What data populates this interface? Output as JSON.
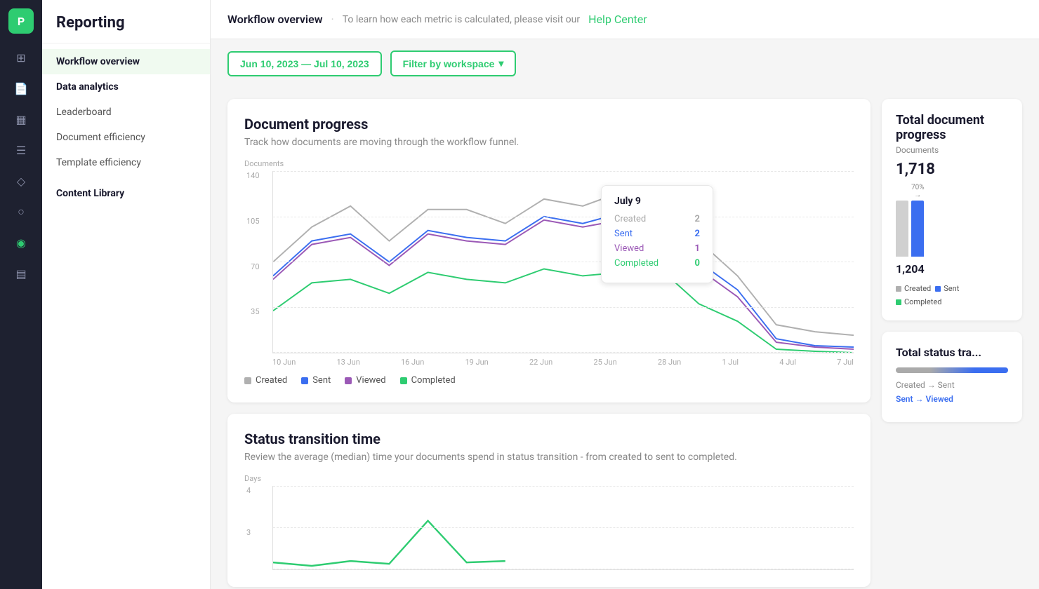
{
  "app": {
    "logo_text": "P"
  },
  "iconbar": {
    "items": [
      {
        "name": "grid-icon",
        "symbol": "⊞",
        "active": false
      },
      {
        "name": "doc-icon",
        "symbol": "📄",
        "active": false
      },
      {
        "name": "template-icon",
        "symbol": "▦",
        "active": false
      },
      {
        "name": "table-icon",
        "symbol": "⊟",
        "active": false
      },
      {
        "name": "tag-icon",
        "symbol": "🏷",
        "active": false
      },
      {
        "name": "user-icon",
        "symbol": "👤",
        "active": false
      },
      {
        "name": "chart-icon",
        "symbol": "📊",
        "active": true
      },
      {
        "name": "slides-icon",
        "symbol": "▤",
        "active": false
      }
    ]
  },
  "sidebar": {
    "title": "Reporting",
    "items": [
      {
        "label": "Workflow overview",
        "active": true,
        "bold": true
      },
      {
        "label": "Data analytics",
        "active": false,
        "bold": true
      },
      {
        "label": "Leaderboard",
        "active": false,
        "bold": false
      },
      {
        "label": "Document efficiency",
        "active": false,
        "bold": false
      },
      {
        "label": "Template efficiency",
        "active": false,
        "bold": false
      },
      {
        "label": "Content Library",
        "active": false,
        "bold": true
      }
    ]
  },
  "topbar": {
    "title": "Workflow overview",
    "help_text": "To learn how each metric is calculated, please visit our",
    "help_link_text": "Help Center",
    "help_link_url": "#"
  },
  "filters": {
    "date_range": "Jun 10, 2023 — Jul 10, 2023",
    "workspace_filter": "Filter by workspace",
    "chevron": "▾"
  },
  "document_progress": {
    "title": "Document progress",
    "subtitle": "Track how documents are moving through the workflow funnel.",
    "y_label": "Documents",
    "y_ticks": [
      "140",
      "105",
      "70",
      "35",
      ""
    ],
    "x_ticks": [
      "10 Jun",
      "13 Jun",
      "16 Jun",
      "19 Jun",
      "22 Jun",
      "25 Jun",
      "28 Jun",
      "1 Jul",
      "4 Jul",
      "7 Jul"
    ],
    "legend": [
      {
        "label": "Created",
        "color": "#b0b0b0"
      },
      {
        "label": "Sent",
        "color": "#3b6ef0"
      },
      {
        "label": "Viewed",
        "color": "#9b59b6"
      },
      {
        "label": "Completed",
        "color": "#2ecc71"
      }
    ],
    "tooltip": {
      "date": "July 9",
      "rows": [
        {
          "label": "Created",
          "value": "2",
          "color_class": "color-created"
        },
        {
          "label": "Sent",
          "value": "2",
          "color_class": "color-sent"
        },
        {
          "label": "Viewed",
          "value": "1",
          "color_class": "color-viewed"
        },
        {
          "label": "Completed",
          "value": "0",
          "color_class": "color-completed"
        }
      ]
    }
  },
  "total_document_progress": {
    "title": "Total document progress",
    "documents_label": "Documents",
    "total_value": "1,718",
    "bar1_value": "1,204",
    "bar1_pct": "70%",
    "legend": [
      {
        "label": "Created",
        "color": "#b0b0b0"
      },
      {
        "label": "Sent",
        "color": "#3b6ef0"
      },
      {
        "label": "Completed",
        "color": "#2ecc71"
      }
    ]
  },
  "status_transition": {
    "title": "Status transition time",
    "subtitle": "Review the average (median) time your documents spend in status transition - from created to sent to completed.",
    "y_label": "Days",
    "y_ticks": [
      "4",
      "3"
    ]
  },
  "total_status_transition": {
    "title": "Total status tra...",
    "progress_label": "Created → Sent",
    "next_label": "Sent → Viewed"
  }
}
